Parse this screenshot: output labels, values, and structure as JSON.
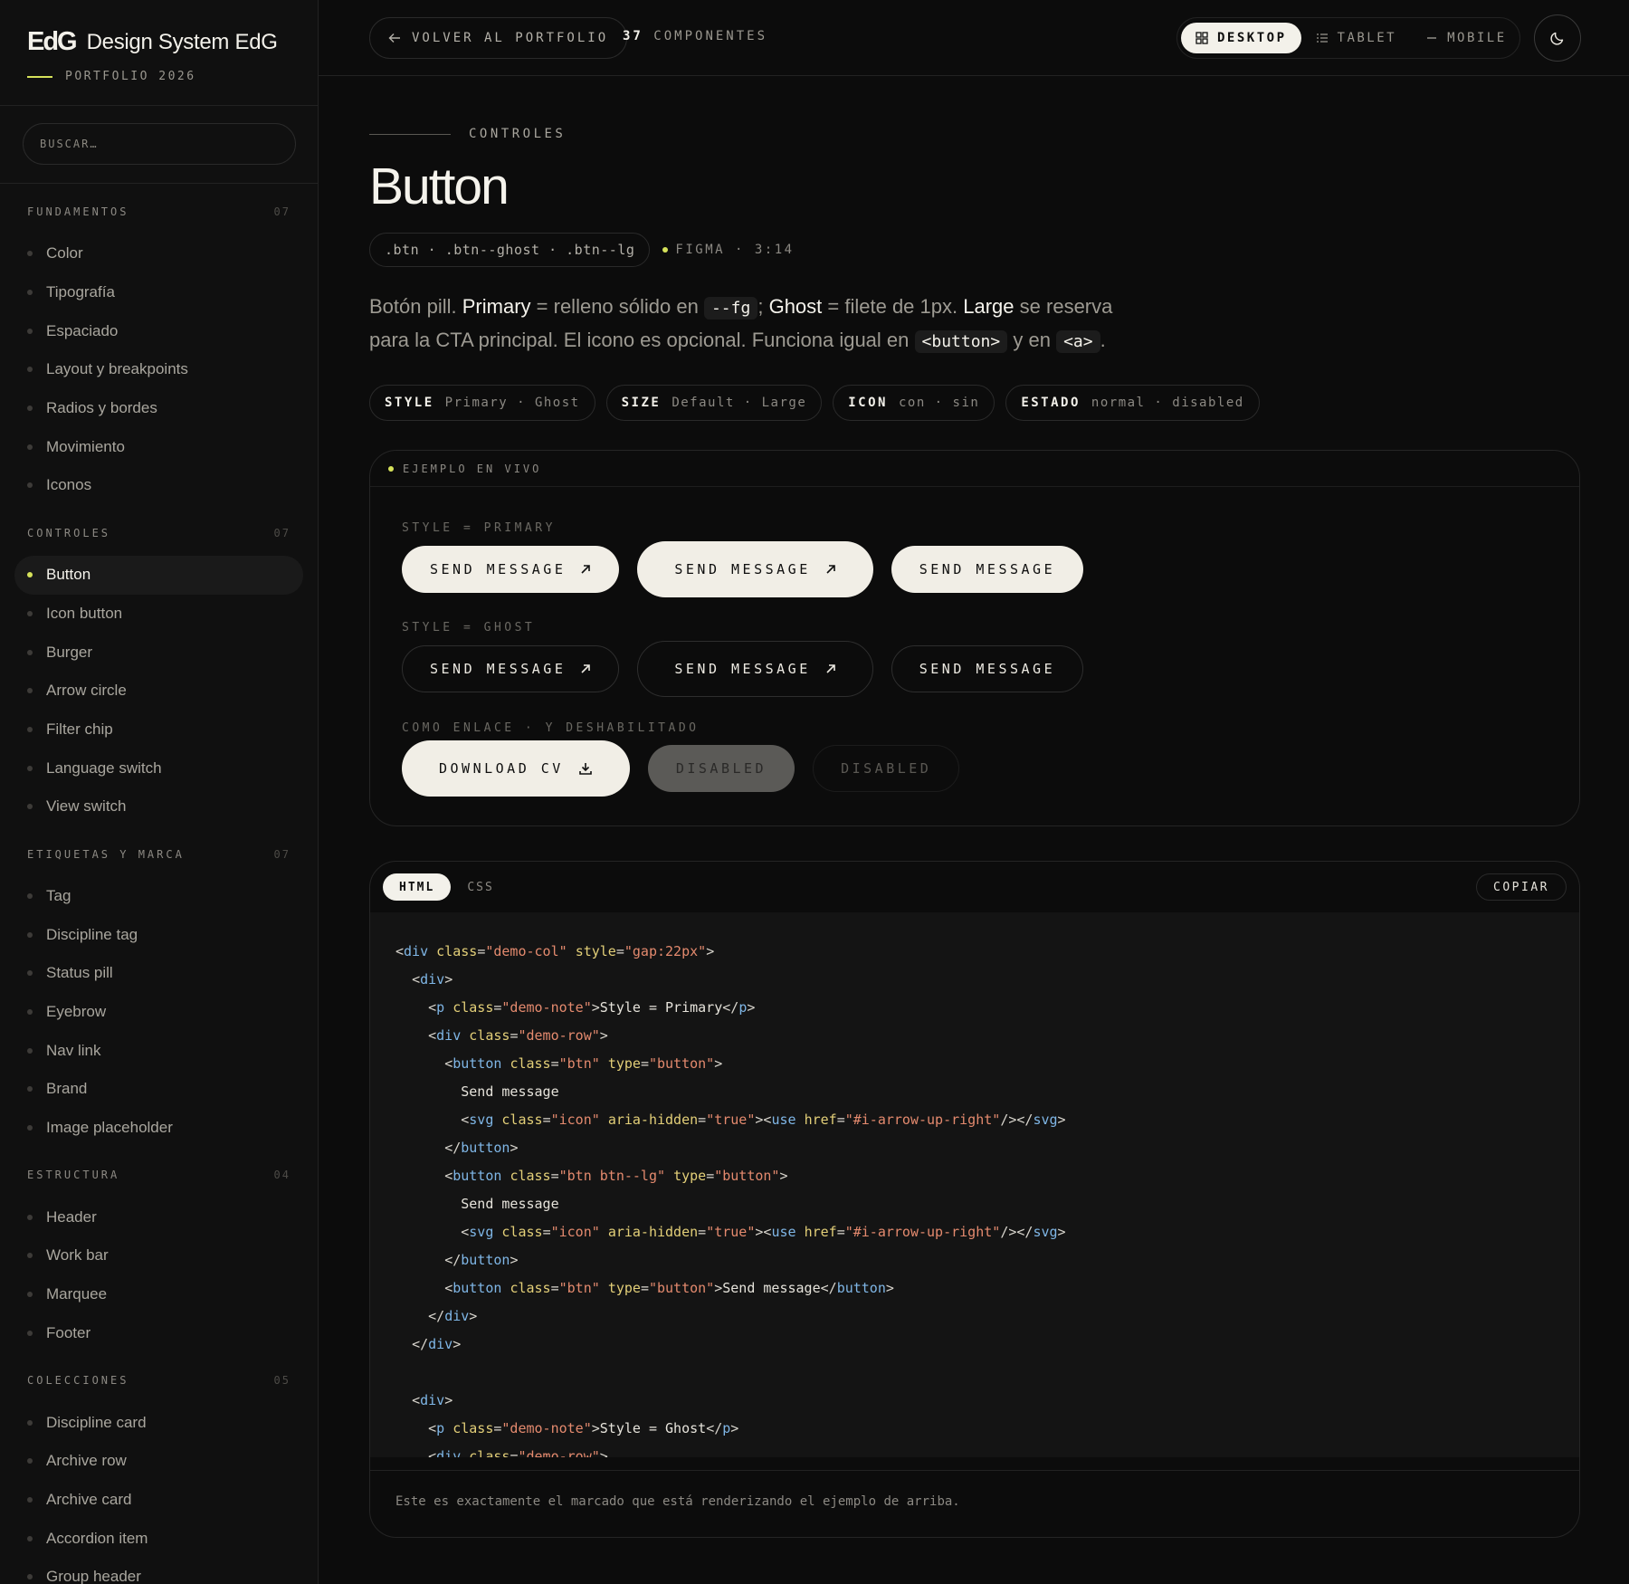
{
  "brand": {
    "logo": "EdG",
    "name": "Design System EdG",
    "subtitle": "PORTFOLIO 2026"
  },
  "search": {
    "placeholder": "BUSCAR…"
  },
  "sidebar": {
    "groups": [
      {
        "title": "FUNDAMENTOS",
        "count": "07",
        "items": [
          "Color",
          "Tipografía",
          "Espaciado",
          "Layout y breakpoints",
          "Radios y bordes",
          "Movimiento",
          "Iconos"
        ]
      },
      {
        "title": "CONTROLES",
        "count": "07",
        "items": [
          "Button",
          "Icon button",
          "Burger",
          "Arrow circle",
          "Filter chip",
          "Language switch",
          "View switch"
        ]
      },
      {
        "title": "ETIQUETAS Y MARCA",
        "count": "07",
        "items": [
          "Tag",
          "Discipline tag",
          "Status pill",
          "Eyebrow",
          "Nav link",
          "Brand",
          "Image placeholder"
        ]
      },
      {
        "title": "ESTRUCTURA",
        "count": "04",
        "items": [
          "Header",
          "Work bar",
          "Marquee",
          "Footer"
        ]
      },
      {
        "title": "COLECCIONES",
        "count": "05",
        "items": [
          "Discipline card",
          "Archive row",
          "Archive card",
          "Accordion item",
          "Group header"
        ]
      }
    ],
    "active_item": "Button"
  },
  "topbar": {
    "back_label": "VOLVER AL PORTFOLIO",
    "count_number": "37",
    "count_label": "COMPONENTES",
    "views": [
      {
        "label": "DESKTOP",
        "icon": "grid-icon",
        "active": true
      },
      {
        "label": "TABLET",
        "icon": "list-icon",
        "active": false
      },
      {
        "label": "MOBILE",
        "icon": "dash-icon",
        "active": false
      }
    ],
    "theme_icon": "moon-icon"
  },
  "page": {
    "eyebrow": "CONTROLES",
    "title": "Button",
    "classes": ".btn · .btn--ghost · .btn--lg",
    "figma": "FIGMA · 3:14",
    "desc": {
      "p1": "Botón pill.",
      "primary": "Primary",
      "p2": "= relleno sólido en",
      "code_fg": "--fg",
      "p3": ";",
      "ghost": "Ghost",
      "p4": "= filete de 1px.",
      "large": "Large",
      "p5": "se reserva para la CTA principal. El icono es opcional. Funciona igual en",
      "code_button": "<button>",
      "p6": "y en",
      "code_a": "<a>",
      "p7": "."
    },
    "props": [
      {
        "key": "STYLE",
        "values": "Primary · Ghost"
      },
      {
        "key": "SIZE",
        "values": "Default · Large"
      },
      {
        "key": "ICON",
        "values": "con · sin"
      },
      {
        "key": "ESTADO",
        "values": "normal · disabled"
      }
    ]
  },
  "demo": {
    "header": "EJEMPLO EN VIVO",
    "note_primary": "STYLE = PRIMARY",
    "note_ghost": "STYLE = GHOST",
    "note_link": "COMO ENLACE · Y DESHABILITADO",
    "send_label": "SEND MESSAGE",
    "download_label": "DOWNLOAD CV",
    "disabled_label": "DISABLED"
  },
  "code": {
    "tabs": [
      "HTML",
      "CSS"
    ],
    "active_tab": "HTML",
    "copy_label": "COPIAR",
    "lines": [
      "<div class=\"demo-col\" style=\"gap:22px\">",
      "  <div>",
      "    <p class=\"demo-note\">Style = Primary</p>",
      "    <div class=\"demo-row\">",
      "      <button class=\"btn\" type=\"button\">",
      "        Send message",
      "        <svg class=\"icon\" aria-hidden=\"true\"><use href=\"#i-arrow-up-right\"/></svg>",
      "      </button>",
      "      <button class=\"btn btn--lg\" type=\"button\">",
      "        Send message",
      "        <svg class=\"icon\" aria-hidden=\"true\"><use href=\"#i-arrow-up-right\"/></svg>",
      "      </button>",
      "      <button class=\"btn\" type=\"button\">Send message</button>",
      "    </div>",
      "  </div>",
      "",
      "  <div>",
      "    <p class=\"demo-note\">Style = Ghost</p>",
      "    <div class=\"demo-row\">"
    ],
    "footer": "Este es exactamente el marcado que está renderizando el ejemplo de arriba."
  },
  "colors": {
    "accent": "#d6e25a",
    "background": "#0c0c0c",
    "surface": "#141414",
    "foreground": "#f1eee6"
  }
}
